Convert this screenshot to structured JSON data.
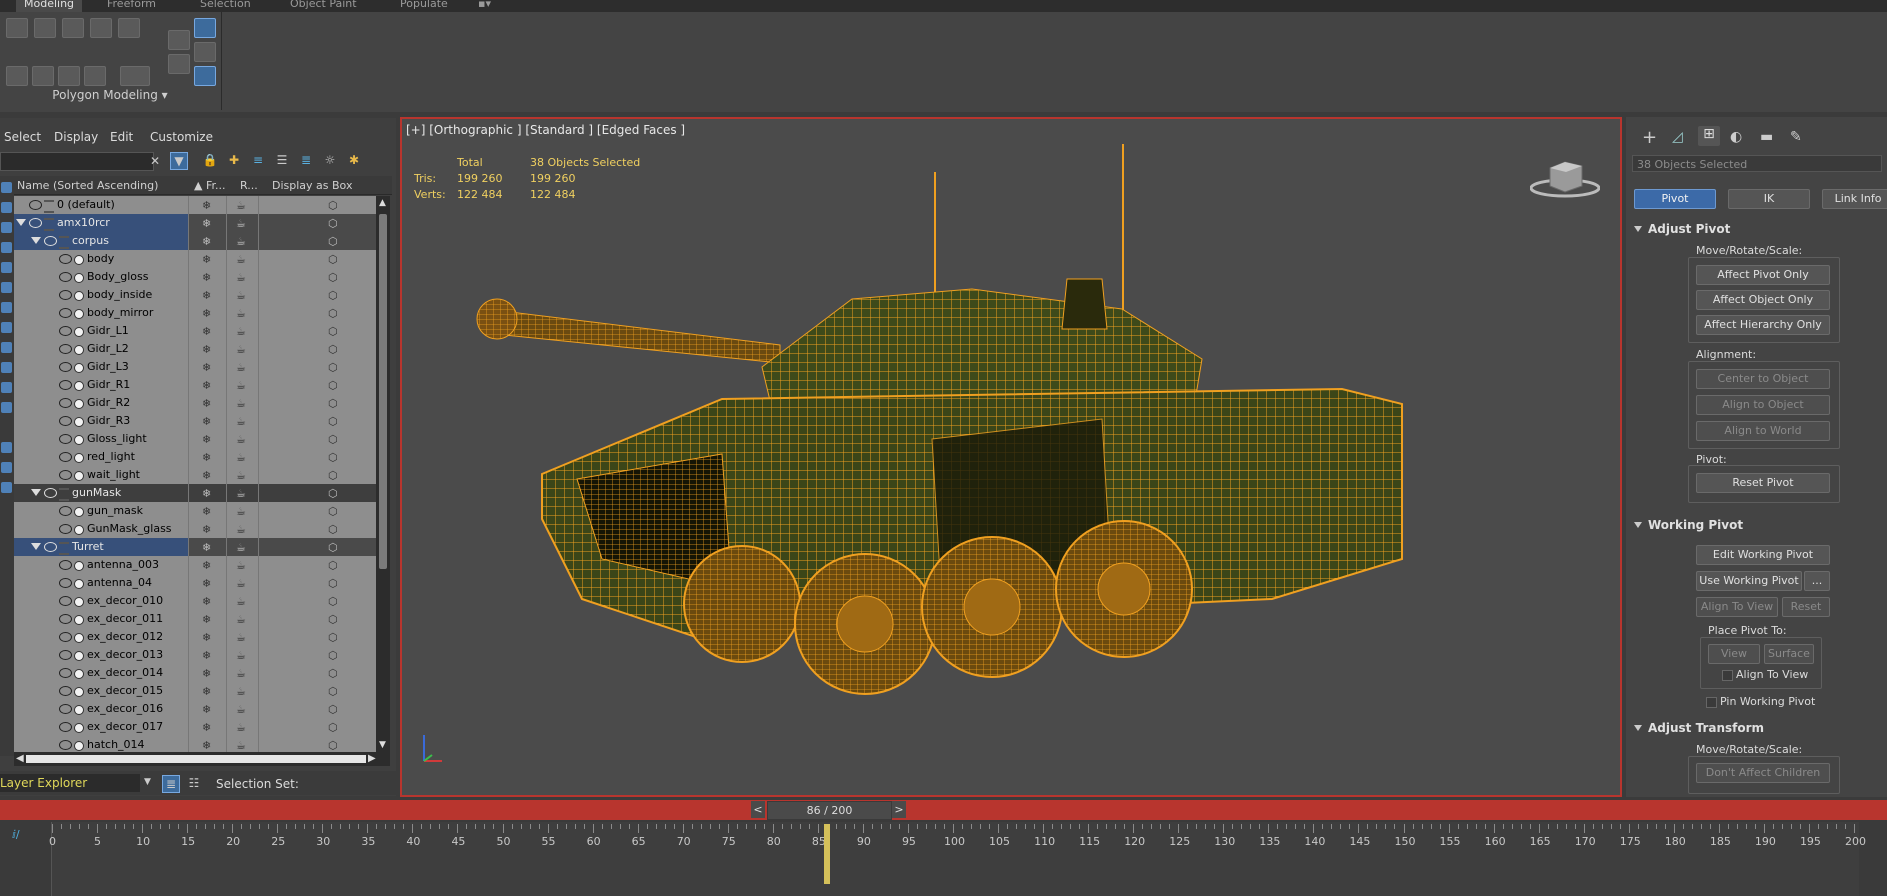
{
  "ribbon": {
    "tabs": [
      "Modeling",
      "Freeform",
      "Selection",
      "Object Paint",
      "Populate"
    ],
    "panel_label": "Polygon Modeling ▾"
  },
  "explorer": {
    "menu": [
      "Select",
      "Display",
      "Edit",
      "Customize"
    ],
    "columns": [
      "Name (Sorted Ascending)",
      "▲ Fr...",
      "R...",
      "Display as Box"
    ],
    "rows": [
      {
        "name": "0 (default)",
        "indent": 0,
        "type": "layer",
        "style": "normal"
      },
      {
        "name": "amx10rcr",
        "indent": 0,
        "type": "layer",
        "style": "sel",
        "expander": true
      },
      {
        "name": "corpus",
        "indent": 1,
        "type": "layer",
        "style": "sel",
        "expander": true
      },
      {
        "name": "body",
        "indent": 2,
        "type": "obj",
        "style": "normal"
      },
      {
        "name": "Body_gloss",
        "indent": 2,
        "type": "obj",
        "style": "normal"
      },
      {
        "name": "body_inside",
        "indent": 2,
        "type": "obj",
        "style": "normal"
      },
      {
        "name": "body_mirror",
        "indent": 2,
        "type": "obj",
        "style": "normal"
      },
      {
        "name": "Gidr_L1",
        "indent": 2,
        "type": "obj",
        "style": "normal"
      },
      {
        "name": "Gidr_L2",
        "indent": 2,
        "type": "obj",
        "style": "normal"
      },
      {
        "name": "Gidr_L3",
        "indent": 2,
        "type": "obj",
        "style": "normal"
      },
      {
        "name": "Gidr_R1",
        "indent": 2,
        "type": "obj",
        "style": "normal"
      },
      {
        "name": "Gidr_R2",
        "indent": 2,
        "type": "obj",
        "style": "normal"
      },
      {
        "name": "Gidr_R3",
        "indent": 2,
        "type": "obj",
        "style": "normal"
      },
      {
        "name": "Gloss_light",
        "indent": 2,
        "type": "obj",
        "style": "normal"
      },
      {
        "name": "red_light",
        "indent": 2,
        "type": "obj",
        "style": "normal"
      },
      {
        "name": "wait_light",
        "indent": 2,
        "type": "obj",
        "style": "normal"
      },
      {
        "name": "gunMask",
        "indent": 1,
        "type": "layer",
        "style": "dark",
        "expander": true
      },
      {
        "name": "gun_mask",
        "indent": 2,
        "type": "obj",
        "style": "normal"
      },
      {
        "name": "GunMask_glass",
        "indent": 2,
        "type": "obj",
        "style": "normal"
      },
      {
        "name": "Turret",
        "indent": 1,
        "type": "layer",
        "style": "sel",
        "expander": true
      },
      {
        "name": "antenna_003",
        "indent": 2,
        "type": "obj",
        "style": "normal"
      },
      {
        "name": "antenna_04",
        "indent": 2,
        "type": "obj",
        "style": "normal"
      },
      {
        "name": "ex_decor_010",
        "indent": 2,
        "type": "obj",
        "style": "normal"
      },
      {
        "name": "ex_decor_011",
        "indent": 2,
        "type": "obj",
        "style": "normal"
      },
      {
        "name": "ex_decor_012",
        "indent": 2,
        "type": "obj",
        "style": "normal"
      },
      {
        "name": "ex_decor_013",
        "indent": 2,
        "type": "obj",
        "style": "normal"
      },
      {
        "name": "ex_decor_014",
        "indent": 2,
        "type": "obj",
        "style": "normal"
      },
      {
        "name": "ex_decor_015",
        "indent": 2,
        "type": "obj",
        "style": "normal"
      },
      {
        "name": "ex_decor_016",
        "indent": 2,
        "type": "obj",
        "style": "normal"
      },
      {
        "name": "ex_decor_017",
        "indent": 2,
        "type": "obj",
        "style": "normal"
      },
      {
        "name": "hatch_014",
        "indent": 2,
        "type": "obj",
        "style": "normal"
      }
    ],
    "layer_explorer": "Layer Explorer",
    "selection_set": "Selection Set:"
  },
  "viewport": {
    "label": "[+] [Orthographic ] [Standard ] [Edged Faces ]",
    "stats": {
      "total_label": "Total",
      "selected_label": "38 Objects Selected",
      "tris_label": "Tris:",
      "tris_total": "199 260",
      "tris_sel": "199 260",
      "verts_label": "Verts:",
      "verts_total": "122 484",
      "verts_sel": "122 484"
    },
    "wire_color": "#f0a020"
  },
  "command_panel": {
    "selection_name": "38 Objects Selected",
    "tabs": [
      "Pivot",
      "IK",
      "Link Info"
    ],
    "adjust_pivot": {
      "title": "Adjust Pivot",
      "move_label": "Move/Rotate/Scale:",
      "buttons": [
        "Affect Pivot Only",
        "Affect Object Only",
        "Affect Hierarchy Only"
      ],
      "alignment_label": "Alignment:",
      "align_buttons": [
        "Center to Object",
        "Align to Object",
        "Align to World"
      ],
      "pivot_label": "Pivot:",
      "reset_button": "Reset Pivot"
    },
    "working_pivot": {
      "title": "Working Pivot",
      "edit_button": "Edit Working Pivot",
      "use_button": "Use Working Pivot",
      "ellipsis": "...",
      "align_view": "Align To View",
      "reset": "Reset",
      "place_label": "Place Pivot To:",
      "view": "View",
      "surface": "Surface",
      "align_to_view_chk": "Align To View",
      "pin_chk": "Pin Working Pivot"
    },
    "adjust_transform": {
      "title": "Adjust Transform",
      "move_label": "Move/Rotate/Scale:",
      "dont_affect": "Don't Affect Children"
    }
  },
  "timeline": {
    "current": "86 / 200",
    "prev": "<",
    "next": ">",
    "current_frame": 86,
    "labels": [
      "0",
      "5",
      "10",
      "15",
      "20",
      "25",
      "30",
      "35",
      "40",
      "45",
      "50",
      "55",
      "60",
      "65",
      "70",
      "75",
      "80",
      "85",
      "90",
      "95",
      "100",
      "105",
      "110",
      "115",
      "120",
      "125",
      "130",
      "135",
      "140",
      "145",
      "150",
      "155",
      "160",
      "165",
      "170",
      "175",
      "180",
      "185",
      "190",
      "195",
      "200"
    ]
  }
}
